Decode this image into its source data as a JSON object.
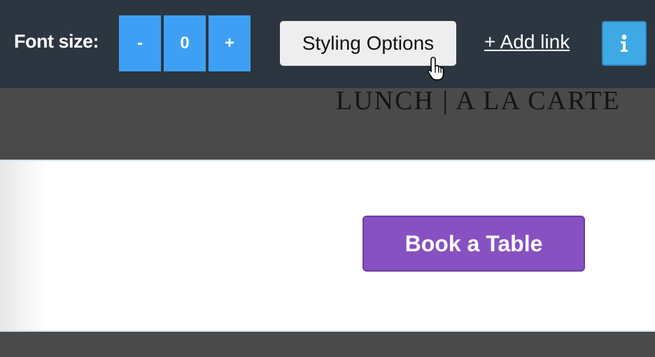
{
  "toolbar": {
    "font_size_label": "Font size:",
    "stepper": {
      "minus_label": "-",
      "value": "0",
      "plus_label": "+"
    },
    "styling_options_label": "Styling Options",
    "add_link_label": "+ Add link",
    "info_icon": "info-icon",
    "cursor_icon": "hand-pointer-cursor"
  },
  "section": {
    "heading": "LUNCH | A LA CARTE",
    "book_button_label": "Book a Table"
  },
  "colors": {
    "toolbar_bg": "#2c3640",
    "stepper_blue": "#3ea0f5",
    "info_blue": "#3fa9e5",
    "book_purple": "#8751c1",
    "page_gray": "#4a4a4a"
  }
}
